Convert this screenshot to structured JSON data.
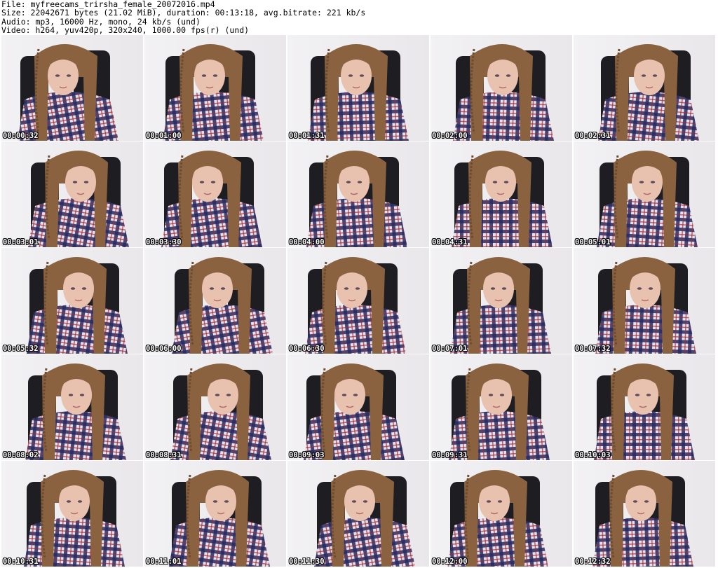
{
  "header": {
    "file": "File: myfreecams_trirsha_female_20072016.mp4",
    "size": "Size: 22042671 bytes (21.02 MiB), duration: 00:13:18, avg.bitrate: 221 kb/s",
    "audio": "Audio: mp3, 16000 Hz, mono, 24 kb/s (und)",
    "video": "Video: h264, yuv420p, 320x240, 1000.00 fps(r) (und)"
  },
  "thumbnails": [
    "00:00:32",
    "00:01:00",
    "00:01:31",
    "00:02:00",
    "00:02:31",
    "00:03:01",
    "00:03:30",
    "00:04:00",
    "00:04:31",
    "00:05:01",
    "00:05:32",
    "00:06:00",
    "00:06:30",
    "00:07:01",
    "00:07:32",
    "00:08:02",
    "00:08:31",
    "00:09:03",
    "00:09:31",
    "00:10:03",
    "00:10:31",
    "00:11:01",
    "00:11:30",
    "00:12:00",
    "00:12:32"
  ],
  "colors": {
    "wall": "#e9e7ea",
    "chair": "#1d1d22",
    "hair": "#8a6240",
    "skin": "#e8c2ae",
    "shirt_base": "#e6e0ea",
    "shirt_check": "#2b2a5e",
    "shirt_accent": "#9a2a3a"
  }
}
